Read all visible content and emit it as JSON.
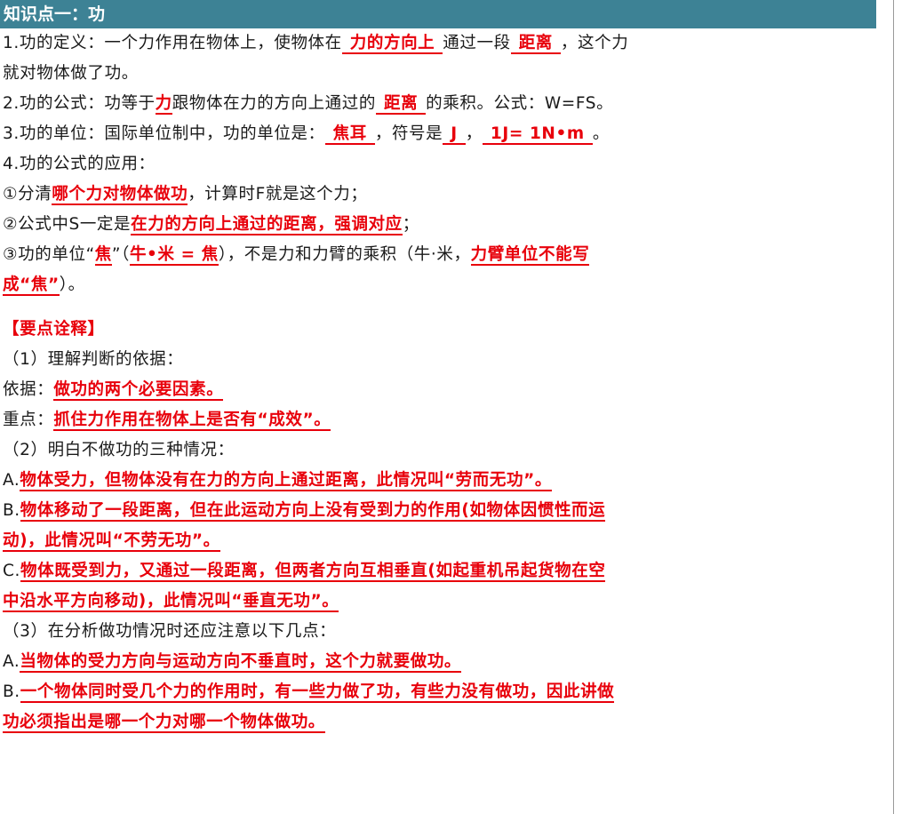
{
  "section_title": "知识点一：功",
  "definition": {
    "line1_a": "1.功的定义：一个力作用在物体上，使物体在",
    "ans1": "力的方向上",
    "line1_b": "通过一段",
    "ans2": "距离",
    "line1_c": "，这个力",
    "line2": "就对物体做了功。"
  },
  "formula": {
    "a": "2.功的公式：功等于",
    "ans1": "力",
    "b": "跟物体在力的方向上通过的",
    "ans2": "距离",
    "c": "的乘积。公式：W=FS。"
  },
  "unit": {
    "a": "3.功的单位：国际单位制中，功的单位是：",
    "ans1": "焦耳",
    "b": "，符号是",
    "ans2": "J",
    "c": "，",
    "ans3": "1J= 1N•m",
    "d": "。"
  },
  "application": {
    "title": "4.功的公式的应用：",
    "item1_a": "①分清",
    "item1_ans": "哪个力对物体做功",
    "item1_b": "，计算时F就是这个力；",
    "item2_a": "②公式中S一定是",
    "item2_ans": "在力的方向上通过的距离，强调对应",
    "item2_b": "；",
    "item3_a": "③功的单位“",
    "item3_ans1": "焦",
    "item3_b": "”（",
    "item3_ans2": "牛•米 = 焦",
    "item3_c": "），不是力和力臂的乘积（牛·米，",
    "item3_ans3a": "力臂单位不能写",
    "item3_ans3b": "成“焦”",
    "item3_d": "）。"
  },
  "tips_title": "【要点诠释】",
  "part1": {
    "title": "（1）理解判断的依据：",
    "basis_label": "依据：",
    "basis_ans": "做功的两个必要因素。",
    "key_label": "重点：",
    "key_ans": "抓住力作用在物体上是否有“成效”。"
  },
  "part2": {
    "title": "（2）明白不做功的三种情况：",
    "a_label": "A.",
    "a_ans": "物体受力，但物体没有在力的方向上通过距离，此情况叫“劳而无功”。",
    "b_label": "B.",
    "b_ans_line1": "物体移动了一段距离，但在此运动方向上没有受到力的作用(如物体因惯性而运",
    "b_ans_line2": "动)，此情况叫“不劳无功”。",
    "c_label": "C.",
    "c_ans_line1": "物体既受到力，又通过一段距离，但两者方向互相垂直(如起重机吊起货物在空",
    "c_ans_line2": "中沿水平方向移动)，此情况叫“垂直无功”。"
  },
  "part3": {
    "title": "（3）在分析做功情况时还应注意以下几点：",
    "a_label": "A.",
    "a_ans": "当物体的受力方向与运动方向不垂直时，这个力就要做功。",
    "b_label": "B.",
    "b_ans_line1": "一个物体同时受几个力的作用时，有一些力做了功，有些力没有做功，因此讲做",
    "b_ans_line2": "功必须指出是哪一个力对哪一个物体做功。"
  },
  "colors": {
    "header_bg": "#3d8295",
    "answer_red": "#e8000b",
    "text": "#1a1a1a"
  }
}
